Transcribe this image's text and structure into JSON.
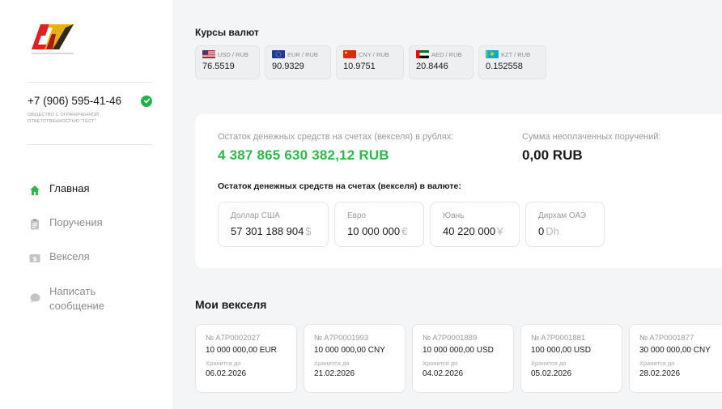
{
  "sidebar": {
    "phone": "+7 (906) 595-41-46",
    "company": "ОБЩЕСТВО С ОГРАНИЧЕННОЙ ОТВЕТСТВЕННОСТЬЮ \"ТЕСТ\"",
    "nav": [
      {
        "label": "Главная",
        "icon": "home-icon",
        "active": true
      },
      {
        "label": "Поручения",
        "icon": "clipboard-icon",
        "active": false
      },
      {
        "label": "Векселя",
        "icon": "dollar-note-icon",
        "active": false
      },
      {
        "label": "Написать сообщение",
        "icon": "chat-bubble-icon",
        "active": false
      }
    ],
    "colors": {
      "active": "#1a1a1a",
      "inactive": "#8c8c8c",
      "accent_green": "#22b24c"
    }
  },
  "rates": {
    "title": "Курсы валют",
    "items": [
      {
        "pair": "USD / RUB",
        "value": "76.5519",
        "flag": "usa-flag-icon"
      },
      {
        "pair": "EUR / RUB",
        "value": "90.9329",
        "flag": "eu-flag-icon"
      },
      {
        "pair": "CNY / RUB",
        "value": "10.9751",
        "flag": "china-flag-icon"
      },
      {
        "pair": "AED / RUB",
        "value": "20.8446",
        "flag": "uae-flag-icon"
      },
      {
        "pair": "KZT / RUB",
        "value": "0.152558",
        "flag": "kazakhstan-flag-icon"
      }
    ]
  },
  "balance": {
    "rub_label": "Остаток денежных средств на счетах (векселя) в рублях:",
    "rub_value": "4 387 865 630 382,12 RUB",
    "unpaid_label": "Сумма неоплаченных поручений:",
    "unpaid_value": "0,00 RUB",
    "currency_label": "Остаток денежных средств на счетах (векселя) в валюте:",
    "currencies": [
      {
        "name": "Доллар США",
        "value": "57 301 188 904",
        "symbol": "$"
      },
      {
        "name": "Евро",
        "value": "10 000 000",
        "symbol": "€"
      },
      {
        "name": "Юань",
        "value": "40 220 000",
        "symbol": "¥"
      },
      {
        "name": "Дирхам ОАЭ",
        "value": "0",
        "symbol": "Dh"
      }
    ],
    "green": "#2fb84a"
  },
  "bills": {
    "title": "Мои векселя",
    "store_label": "Хранится до",
    "items": [
      {
        "number": "№ A7P0002027",
        "amount": "10 000 000,00 EUR",
        "date": "06.02.2026"
      },
      {
        "number": "№ A7P0001993",
        "amount": "10 000 000,00 CNY",
        "date": "21.02.2026"
      },
      {
        "number": "№ A7P0001889",
        "amount": "10 000 000,00 USD",
        "date": "04.02.2026"
      },
      {
        "number": "№ A7P0001881",
        "amount": "100 000,00 USD",
        "date": "05.02.2026"
      },
      {
        "number": "№ A7P0001877",
        "amount": "30 000 000,00 CNY",
        "date": "28.02.2026"
      }
    ]
  }
}
